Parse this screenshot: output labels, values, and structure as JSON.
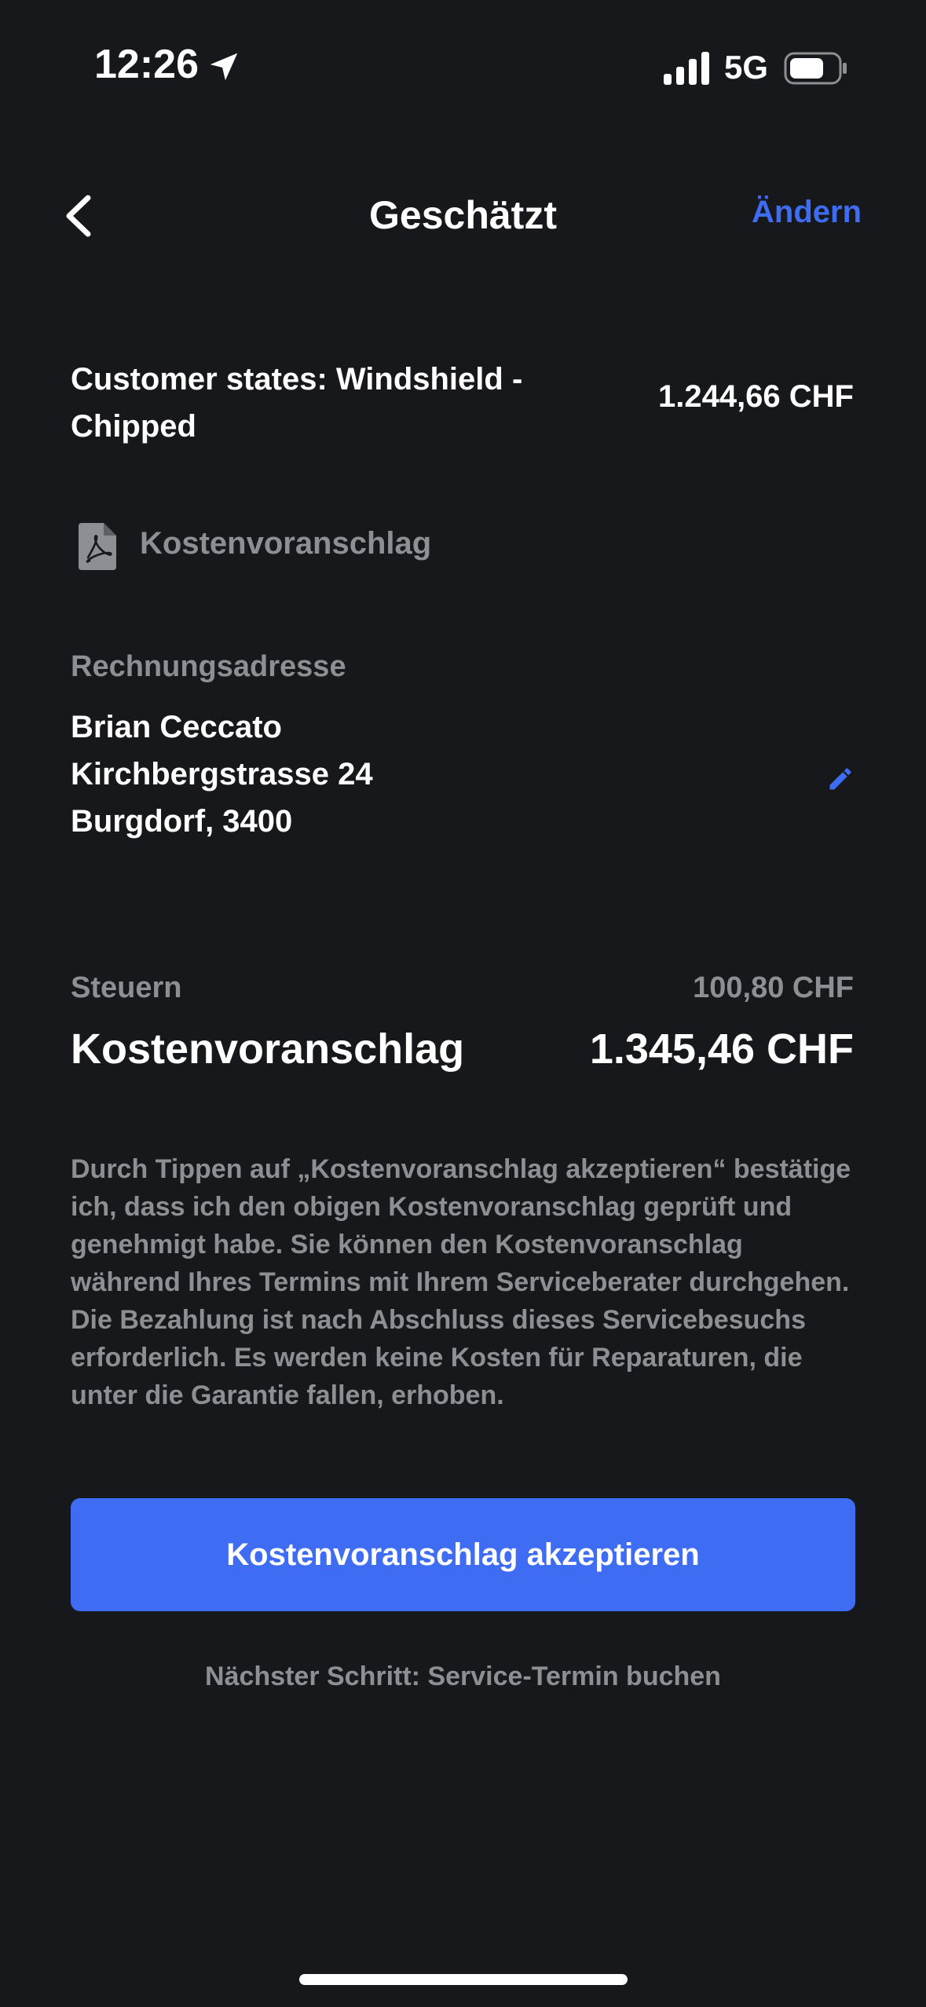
{
  "status_bar": {
    "time": "12:26",
    "network": "5G",
    "icons": [
      "location-arrow-icon",
      "signal-icon",
      "battery-icon"
    ]
  },
  "nav": {
    "title": "Geschätzt",
    "edit_label": "Ändern",
    "back_icon": "chevron-left-icon"
  },
  "line_item": {
    "description": "Customer states: Windshield - Chipped",
    "price": "1.244,66 CHF"
  },
  "document": {
    "icon": "pdf-file-icon",
    "label": "Kostenvoranschlag"
  },
  "billing_address": {
    "label": "Rechnungsadresse",
    "name": "Brian Ceccato",
    "street": "Kirchbergstrasse 24",
    "city": "Burgdorf, 3400",
    "edit_icon": "pencil-icon"
  },
  "totals": {
    "tax_label": "Steuern",
    "tax_value": "100,80 CHF",
    "total_label": "Kostenvoranschlag",
    "total_value": "1.345,46 CHF"
  },
  "disclaimer": "Durch Tippen auf „Kostenvoranschlag akzeptieren“ bestätige ich, dass ich den obigen Kostenvoranschlag geprüft und genehmigt habe. Sie können den Kostenvoranschlag während Ihres Termins mit Ihrem Serviceberater durchgehen. Die Bezahlung ist nach Abschluss dieses Servicebesuchs erforderlich. Es werden keine Kosten für Reparaturen, die unter die Garantie fallen, erhoben.",
  "actions": {
    "accept_label": "Kostenvoranschlag akzeptieren",
    "next_step": "Nächster Schritt: Service-Termin buchen"
  },
  "colors": {
    "background": "#17181b",
    "accent": "#3e6cf2",
    "muted_text": "#8d8f95",
    "text": "#ffffff"
  }
}
